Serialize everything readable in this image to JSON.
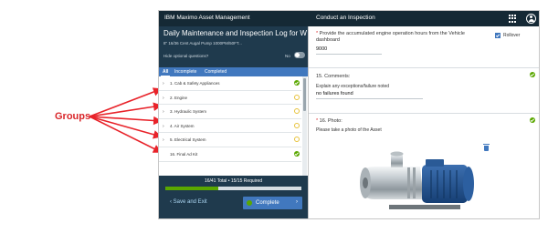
{
  "annotation": {
    "label": "Groups",
    "color": "#d9262a"
  },
  "header": {
    "app_title": "IBM Maximo Asset Management",
    "page_title": "Conduct an Inspection",
    "apps_icon": "grid-icon",
    "user_icon": "user-icon"
  },
  "form": {
    "title": "Daily Maintenance and Inspection Log for Wo",
    "asset": "8\" 16/36 Cent Augal Pump 1000PM/50FT...",
    "hide_optional": "Hide optional questions?",
    "toggle_state": "No"
  },
  "filters": {
    "all": "All",
    "incomplete": "Incomplete",
    "completed": "Completed",
    "active": "All"
  },
  "groups": [
    {
      "chevron": "›",
      "label": "1. Cab & Safety Appliances",
      "status": "complete"
    },
    {
      "chevron": "›",
      "label": "2. Engine",
      "status": "incomplete"
    },
    {
      "chevron": "›",
      "label": "3. Hydraulic System",
      "status": "incomplete"
    },
    {
      "chevron": "›",
      "label": "4. Air System",
      "status": "incomplete"
    },
    {
      "chevron": "›",
      "label": "5. Electrical System",
      "status": "incomplete"
    },
    {
      "chevron": "",
      "label": "16. Final Ad Kit",
      "status": "complete"
    }
  ],
  "footer": {
    "total": "16/41 Total",
    "separator": "•",
    "required": "15/15 Required",
    "progress_fraction": 0.39,
    "save_exit": "‹  Save and Exit",
    "complete": "Complete",
    "complete_arrow": "›"
  },
  "questions": {
    "q1": {
      "required_mark": "*",
      "text": "Provide the accumulated engine operation hours from the Vehicle dashboard",
      "value": "9000",
      "rollover": "Rollover"
    },
    "q15": {
      "title": "15. Comments:",
      "instruction": "Explain any exceptions/failure noted",
      "value": "no failures found"
    },
    "q16": {
      "required_mark": "*",
      "title": "16. Photo:",
      "instruction": "Please take a photo of the Asset"
    }
  },
  "colors": {
    "header": "#152935",
    "panel": "#1f3a4d",
    "accent": "#4178be",
    "success": "#5aa700",
    "pending": "#e7c23a"
  }
}
